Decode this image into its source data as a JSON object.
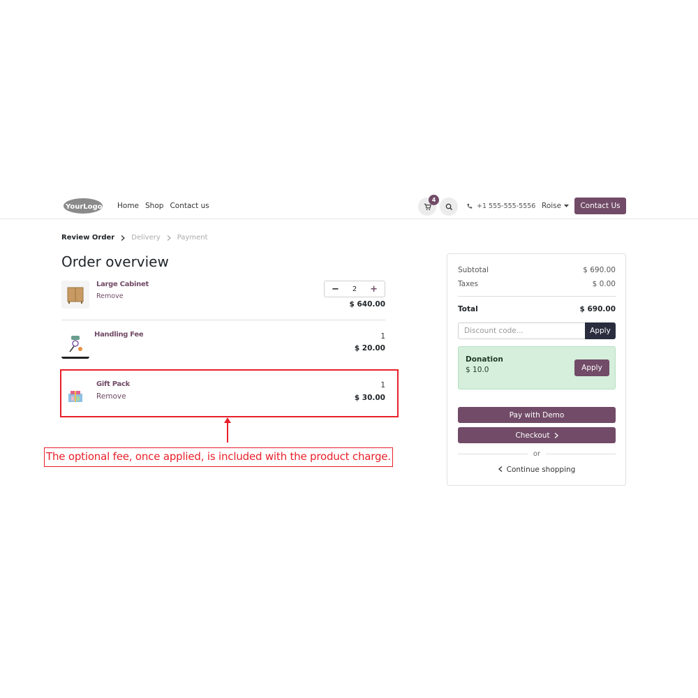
{
  "header": {
    "logo_text": "YourLogo",
    "nav": [
      "Home",
      "Shop",
      "Contact us"
    ],
    "cart_count": "4",
    "phone": "+1 555-555-5556",
    "user_name": "Roise",
    "contact_button": "Contact Us"
  },
  "breadcrumb": {
    "steps": [
      "Review Order",
      "Delivery",
      "Payment"
    ]
  },
  "page_title": "Order overview",
  "products": [
    {
      "name": "Large Cabinet",
      "remove": "Remove",
      "qty": "2",
      "price": "$ 640.00"
    },
    {
      "name": "Handling Fee",
      "qty": "1",
      "price": "$ 20.00"
    },
    {
      "name": "Gift Pack",
      "remove": "Remove",
      "qty": "1",
      "price": "$ 30.00"
    }
  ],
  "annotation": "The optional fee, once applied, is included with the product charge.",
  "summary": {
    "subtotal_label": "Subtotal",
    "subtotal_value": "$ 690.00",
    "taxes_label": "Taxes",
    "taxes_value": "$ 0.00",
    "total_label": "Total",
    "total_value": "$ 690.00",
    "discount_placeholder": "Discount code...",
    "discount_apply": "Apply",
    "donation_title": "Donation",
    "donation_amount": "$ 10.0",
    "donation_apply": "Apply",
    "pay_button": "Pay with Demo",
    "checkout_button": "Checkout",
    "or": "or",
    "continue": "Continue shopping"
  },
  "colors": {
    "brand": "#714b67",
    "annotation": "#e8202a",
    "donation_bg": "#d5efdc",
    "dark_button": "#2a2d3e"
  },
  "icons": [
    "cart-icon",
    "search-icon",
    "phone-icon",
    "caret-down-icon",
    "chevron-right-icon",
    "chevron-left-icon",
    "minus-icon",
    "plus-icon"
  ]
}
